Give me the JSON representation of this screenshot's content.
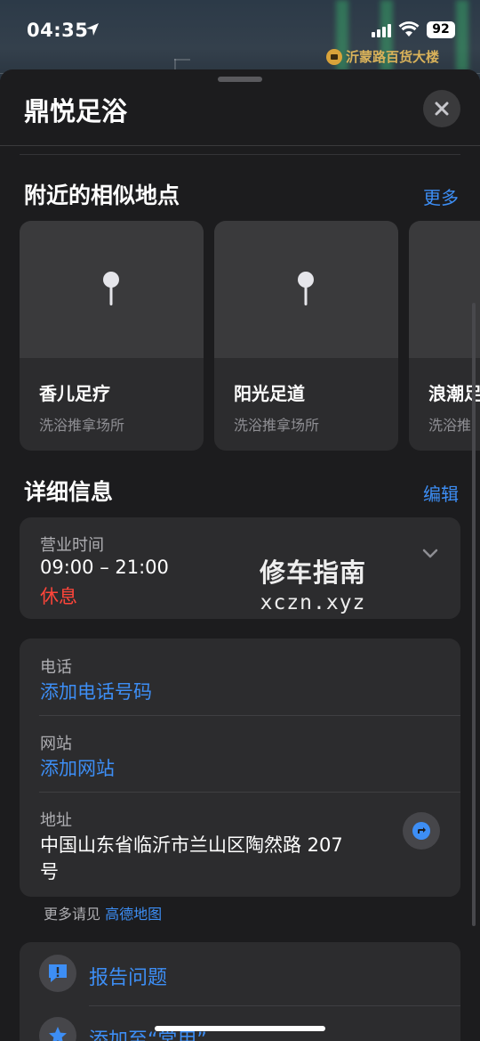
{
  "status": {
    "time": "04:35",
    "battery": "92"
  },
  "map": {
    "poi_label": "沂蒙路百货大楼"
  },
  "sheet": {
    "title": "鼎悦足浴"
  },
  "nearby": {
    "title": "附近的相似地点",
    "more": "更多",
    "places": [
      {
        "name": "香儿足疗",
        "category": "洗浴推拿场所"
      },
      {
        "name": "阳光足道",
        "category": "洗浴推拿场所"
      },
      {
        "name": "浪潮足",
        "category": "洗浴推"
      }
    ]
  },
  "details": {
    "title": "详细信息",
    "edit": "编辑",
    "hours": {
      "label": "营业时间",
      "value": "09:00 – 21:00",
      "status": "休息"
    },
    "phone": {
      "label": "电话",
      "action": "添加电话号码"
    },
    "website": {
      "label": "网站",
      "action": "添加网站"
    },
    "address": {
      "label": "地址",
      "line1": "中国山东省临沂市兰山区陶然路 207",
      "line2": "号"
    },
    "more_prefix": "更多请见",
    "more_source": "高德地图"
  },
  "watermark": {
    "line1": "修车指南",
    "line2": "xczn.xyz"
  },
  "actions": {
    "report": "报告问题",
    "add_favorite": "添加至“常用”"
  },
  "colors": {
    "accent": "#3d8ef5",
    "closed": "#ff453a",
    "background": "#1c1c1e",
    "card": "#2c2c2e"
  }
}
